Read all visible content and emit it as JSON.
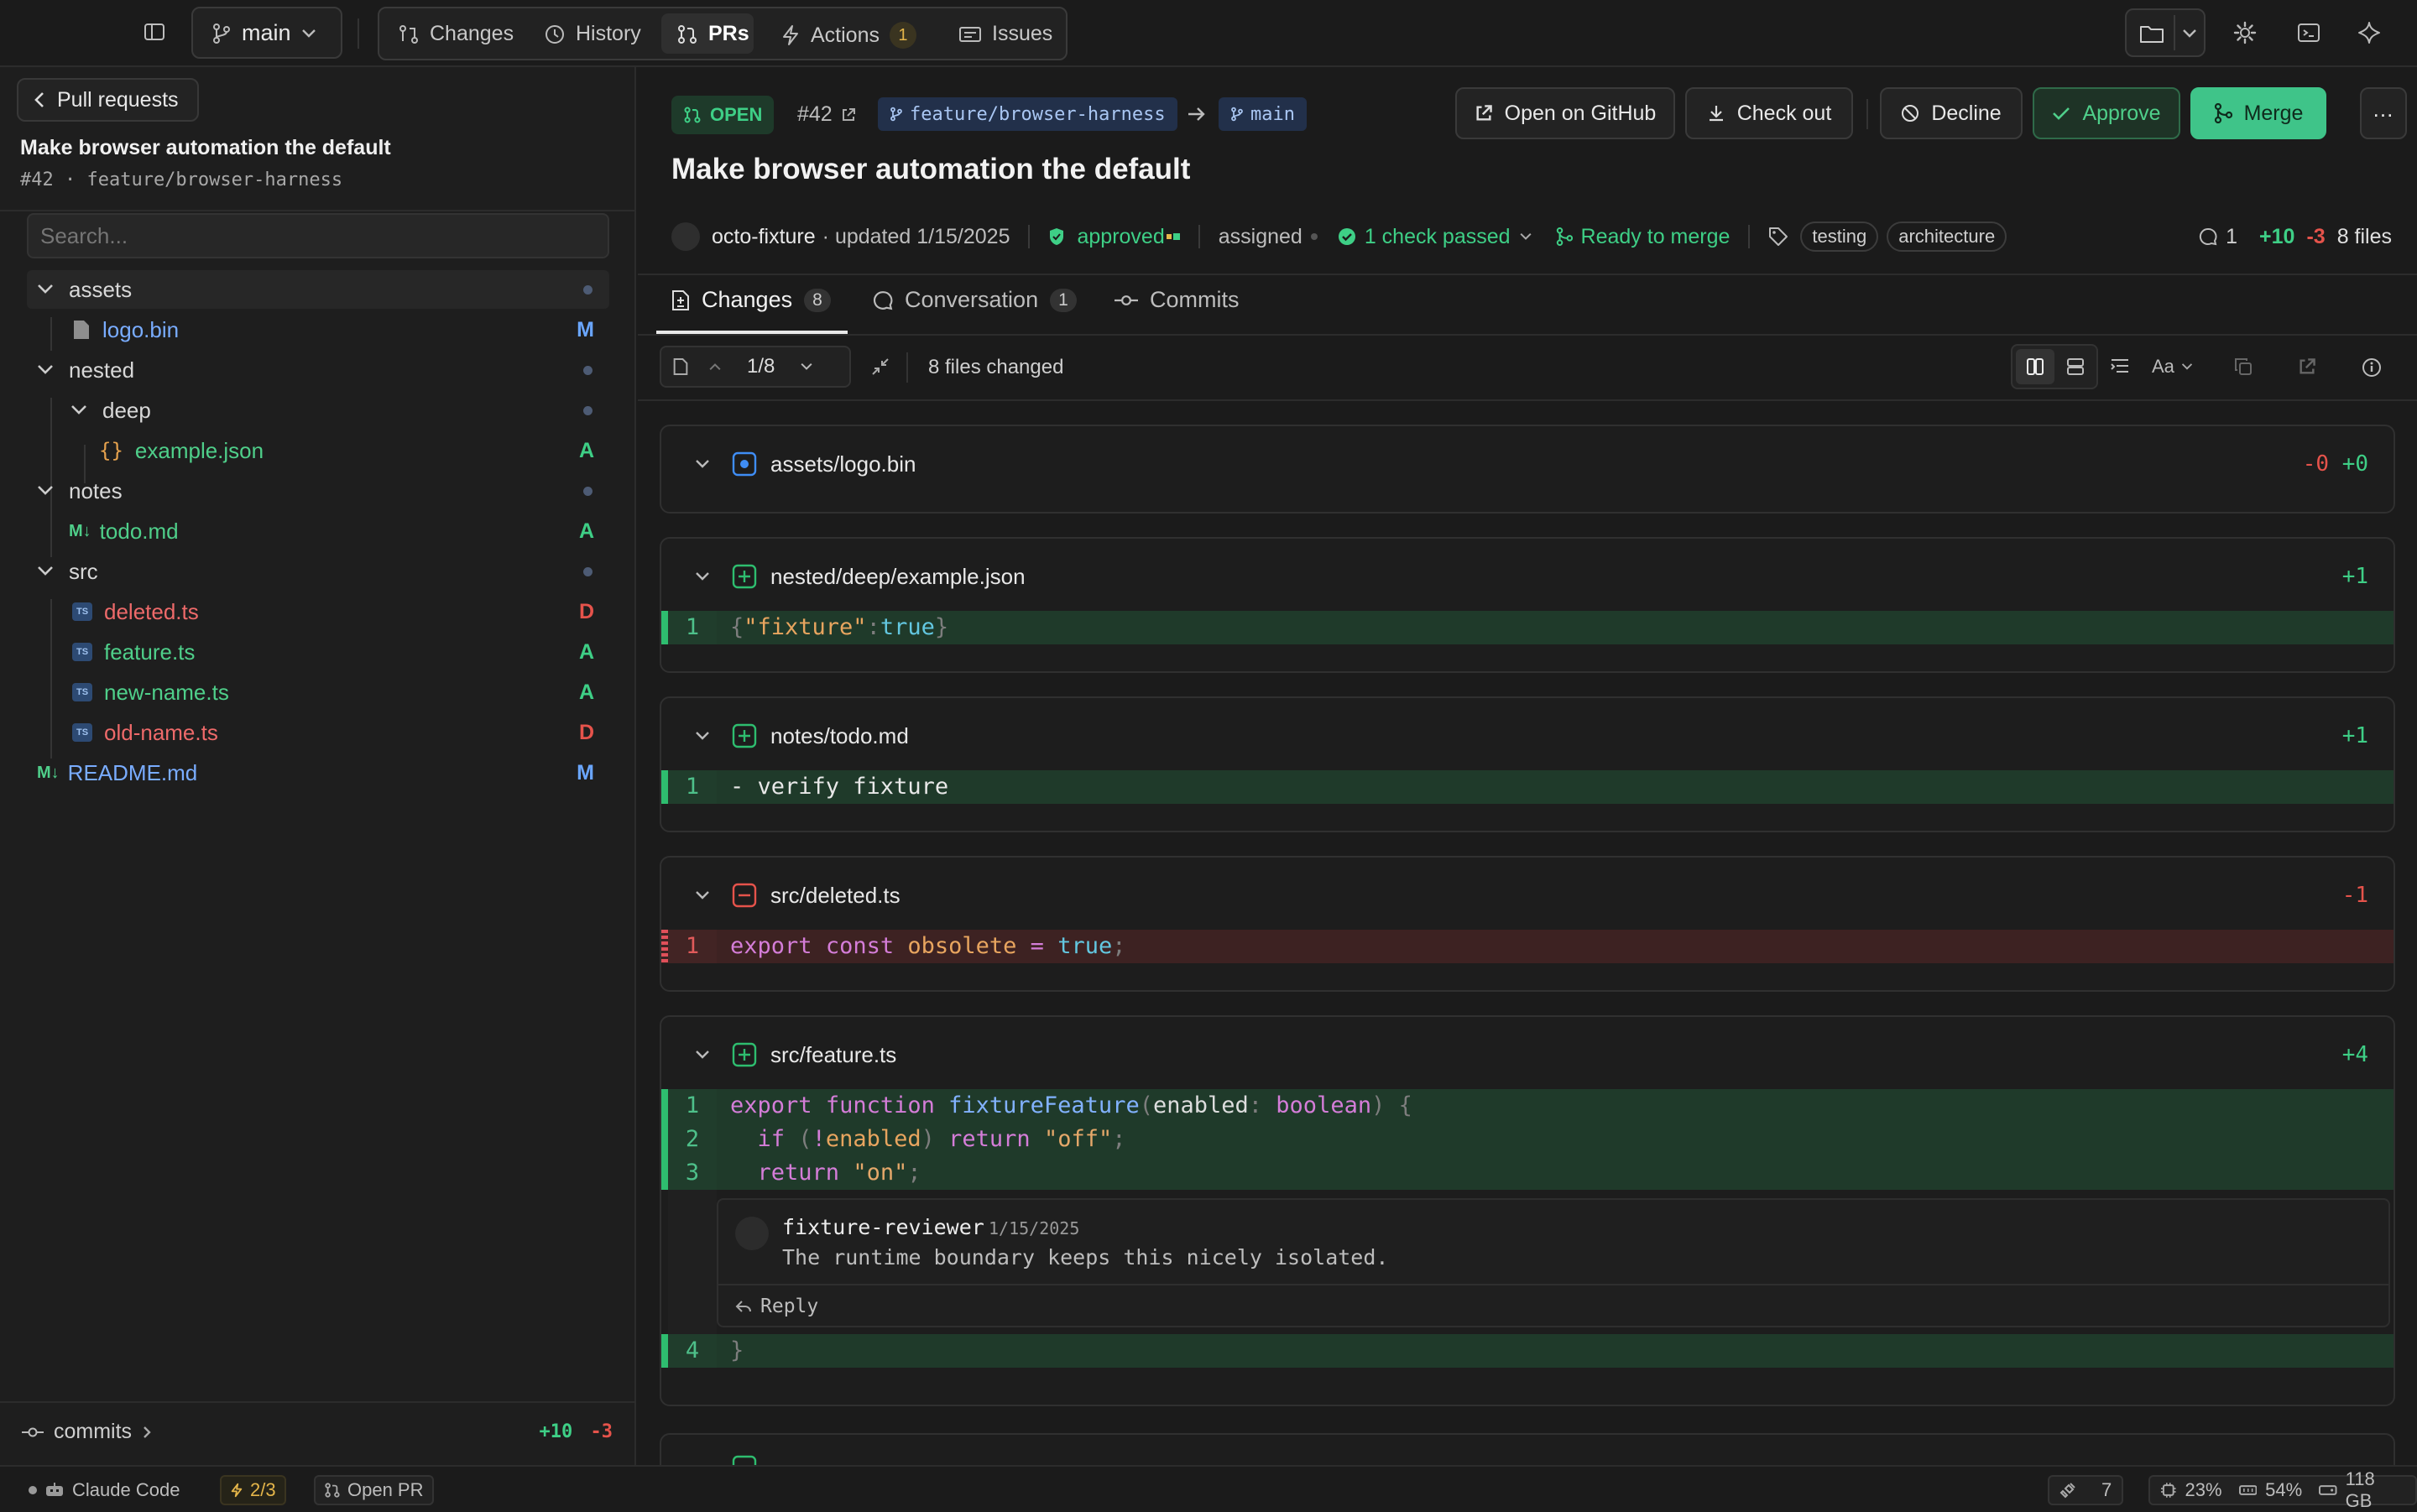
{
  "toolbar": {
    "branch": "main",
    "tabs": [
      {
        "label": "Changes"
      },
      {
        "label": "History"
      },
      {
        "label": "PRs"
      },
      {
        "label": "Actions",
        "count": "1"
      },
      {
        "label": "Issues"
      }
    ]
  },
  "sidebar": {
    "back_label": "Pull requests",
    "pr_title": "Make browser automation the default",
    "pr_sub": "#42 · feature/browser-harness",
    "search_placeholder": "Search...",
    "tree": [
      {
        "label": "assets",
        "type": "folder"
      },
      {
        "label": "logo.bin",
        "type": "file",
        "status": "M"
      },
      {
        "label": "nested",
        "type": "folder"
      },
      {
        "label": "deep",
        "type": "folder"
      },
      {
        "label": "example.json",
        "type": "json",
        "status": "A"
      },
      {
        "label": "notes",
        "type": "folder"
      },
      {
        "label": "todo.md",
        "type": "md",
        "status": "A"
      },
      {
        "label": "src",
        "type": "folder"
      },
      {
        "label": "deleted.ts",
        "type": "ts",
        "status": "D"
      },
      {
        "label": "feature.ts",
        "type": "ts",
        "status": "A"
      },
      {
        "label": "new-name.ts",
        "type": "ts",
        "status": "A"
      },
      {
        "label": "old-name.ts",
        "type": "ts",
        "status": "D"
      },
      {
        "label": "README.md",
        "type": "md",
        "status": "M"
      }
    ],
    "footer": {
      "label": "commits",
      "added": "+10",
      "removed": "-3"
    }
  },
  "pr": {
    "state": "OPEN",
    "number": "#42",
    "head_branch": "feature/browser-harness",
    "base_branch": "main",
    "title": "Make browser automation the default",
    "author": "octo-fixture",
    "updated": "· updated 1/15/2025",
    "review": "approved",
    "assigned": "assigned",
    "checks": "1 check passed",
    "merge_state": "Ready to merge",
    "labels": [
      "testing",
      "architecture"
    ],
    "comments": "1",
    "added": "+10",
    "removed": "-3",
    "files": "8 files",
    "actions": {
      "open_github": "Open on GitHub",
      "checkout": "Check out",
      "decline": "Decline",
      "approve": "Approve",
      "merge": "Merge"
    }
  },
  "tabs": [
    {
      "label": "Changes",
      "count": "8"
    },
    {
      "label": "Conversation",
      "count": "1"
    },
    {
      "label": "Commits"
    }
  ],
  "diff_toolbar": {
    "position": "1/8",
    "summary": "8 files changed"
  },
  "diffs": {
    "logo": {
      "path": "assets/logo.bin",
      "removed": "-0",
      "added": "+0"
    },
    "example": {
      "path": "nested/deep/example.json",
      "stat": "+1"
    },
    "todo": {
      "path": "notes/todo.md",
      "stat": "+1",
      "line": "- verify fixture"
    },
    "deleted": {
      "path": "src/deleted.ts",
      "stat": "-1"
    },
    "feature": {
      "path": "src/feature.ts",
      "stat": "+4"
    }
  },
  "comment": {
    "author": "fixture-reviewer",
    "date": "1/15/2025",
    "body": "The runtime boundary keeps this nicely isolated.",
    "reply": "Reply"
  },
  "statusbar": {
    "agent": "Claude Code",
    "actions": "2/3",
    "open_pr": "Open PR",
    "ports": "7",
    "cpu": "23%",
    "mem": "54%",
    "disk": "118 GB"
  },
  "colors": {
    "accent_green": "#2ebd6f",
    "merge_button": "#3fc489",
    "added": "#3ecf86",
    "removed": "#e5534b",
    "modified": "#6aa6ff"
  }
}
